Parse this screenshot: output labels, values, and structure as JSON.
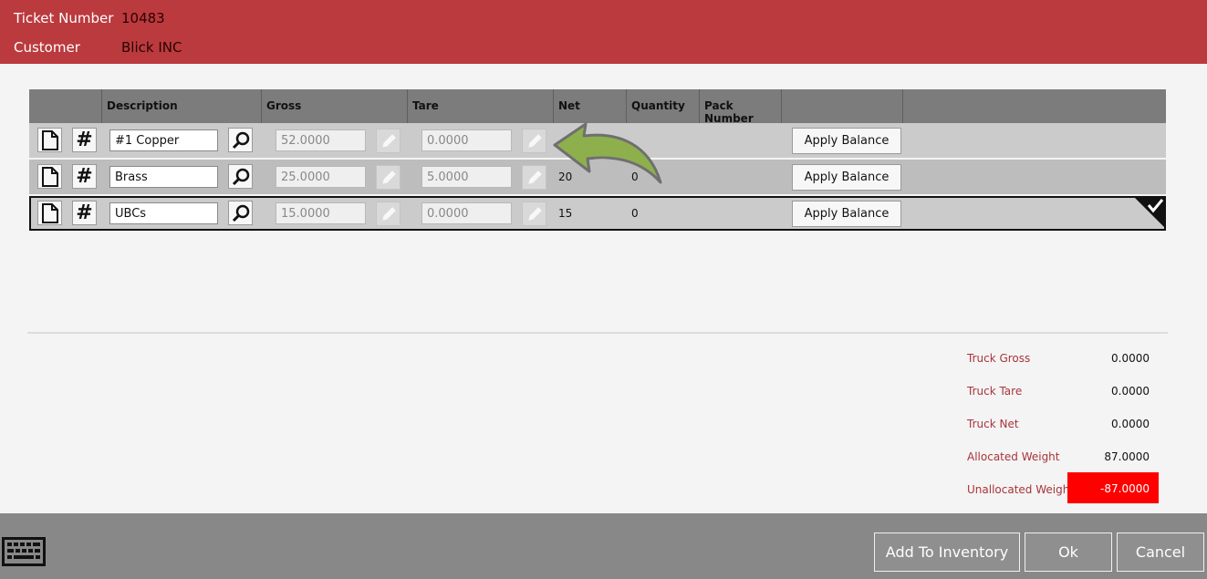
{
  "header": {
    "ticket_label": "Ticket Number",
    "ticket_value": "10483",
    "customer_label": "Customer",
    "customer_value": "Blick INC"
  },
  "columns": {
    "description": "Description",
    "gross": "Gross",
    "tare": "Tare",
    "net": "Net",
    "quantity": "Quantity",
    "pack_number": "Pack Number"
  },
  "rows": [
    {
      "description": "#1 Copper",
      "gross": "52.0000",
      "tare": "0.0000",
      "net": "",
      "quantity": "",
      "apply": "Apply Balance"
    },
    {
      "description": "Brass",
      "gross": "25.0000",
      "tare": "5.0000",
      "net": "20",
      "quantity": "0",
      "apply": "Apply Balance"
    },
    {
      "description": "UBCs",
      "gross": "15.0000",
      "tare": "0.0000",
      "net": "15",
      "quantity": "0",
      "apply": "Apply Balance",
      "selected": true
    }
  ],
  "totals": {
    "truck_gross_label": "Truck Gross",
    "truck_gross": "0.0000",
    "truck_tare_label": "Truck Tare",
    "truck_tare": "0.0000",
    "truck_net_label": "Truck Net",
    "truck_net": "0.0000",
    "allocated_label": "Allocated Weight",
    "allocated": "87.0000",
    "unallocated_label": "Unallocated Weight",
    "unallocated": "-87.0000"
  },
  "footer": {
    "add_to_inventory": "Add To Inventory",
    "ok": "Ok",
    "cancel": "Cancel"
  },
  "icons": {
    "new_doc": "document-icon",
    "hash": "hash-icon",
    "search": "search-icon",
    "edit": "pencil-icon",
    "keyboard": "keyboard-icon",
    "selected": "checkmark-icon"
  },
  "colors": {
    "header": "#bb3a3e",
    "unallocated_bg": "#ff0000",
    "total_label": "#a8353a",
    "footer": "#888888"
  }
}
